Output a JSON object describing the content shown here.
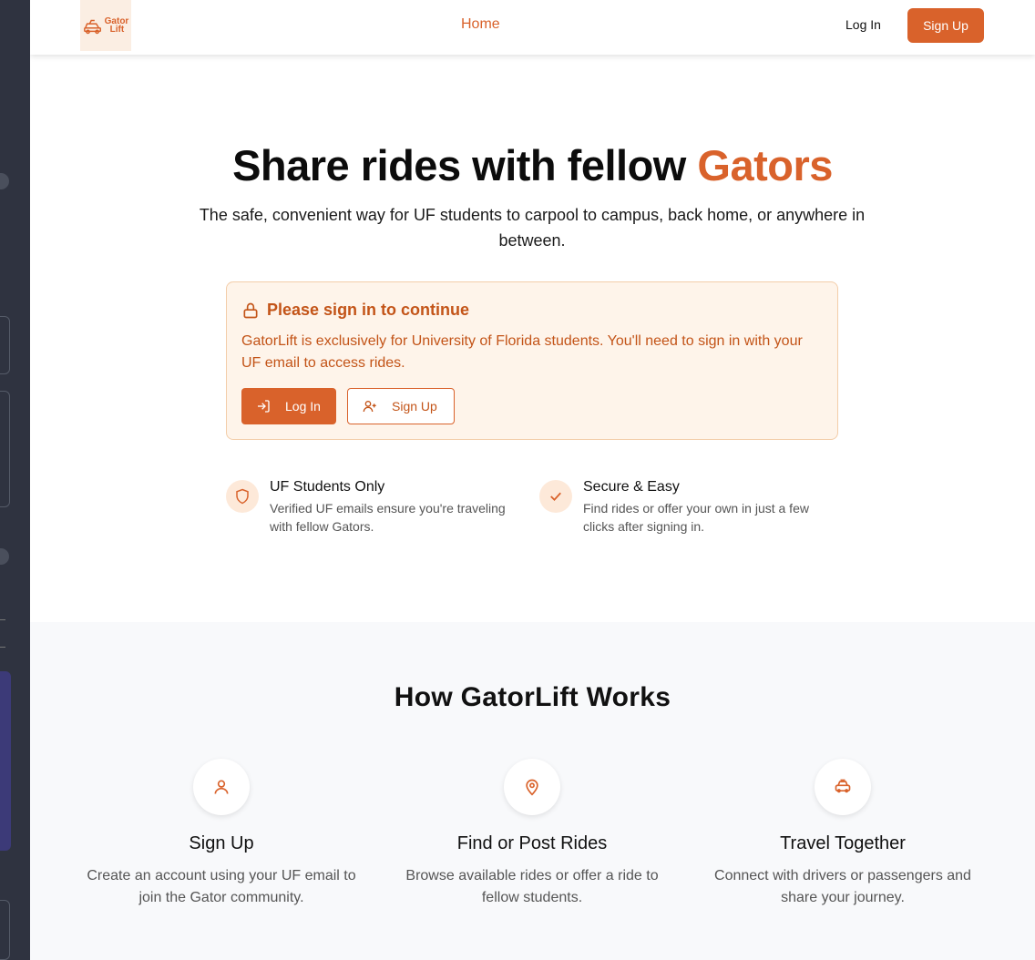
{
  "colors": {
    "accent": "#d9622b",
    "accent_dark": "#c35418",
    "notice_bg": "#fef4ea"
  },
  "header": {
    "logo_line1": "Gator",
    "logo_line2": "Lift",
    "nav_home": "Home",
    "login_label": "Log In",
    "signup_label": "Sign Up"
  },
  "hero": {
    "title_prefix": "Share rides with fellow ",
    "title_accent": "Gators",
    "subtitle": "The safe, convenient way for UF students to carpool to campus, back home, or anywhere in between."
  },
  "notice": {
    "icon": "lock-icon",
    "title": "Please sign in to continue",
    "text": "GatorLift is exclusively for University of Florida students. You'll need to sign in with your UF email to access rides.",
    "login_label": "Log In",
    "signup_label": "Sign Up"
  },
  "features": [
    {
      "icon": "shield-icon",
      "title": "UF Students Only",
      "desc": "Verified UF emails ensure you're traveling with fellow Gators."
    },
    {
      "icon": "check-icon",
      "title": "Secure & Easy",
      "desc": "Find rides or offer your own in just a few clicks after signing in."
    }
  ],
  "how": {
    "title": "How GatorLift Works",
    "steps": [
      {
        "icon": "user-icon",
        "title": "Sign Up",
        "desc": "Create an account using your UF email to join the Gator community."
      },
      {
        "icon": "map-pin-icon",
        "title": "Find or Post Rides",
        "desc": "Browse available rides or offer a ride to fellow students."
      },
      {
        "icon": "car-icon",
        "title": "Travel Together",
        "desc": "Connect with drivers or passengers and share your journey."
      }
    ]
  }
}
